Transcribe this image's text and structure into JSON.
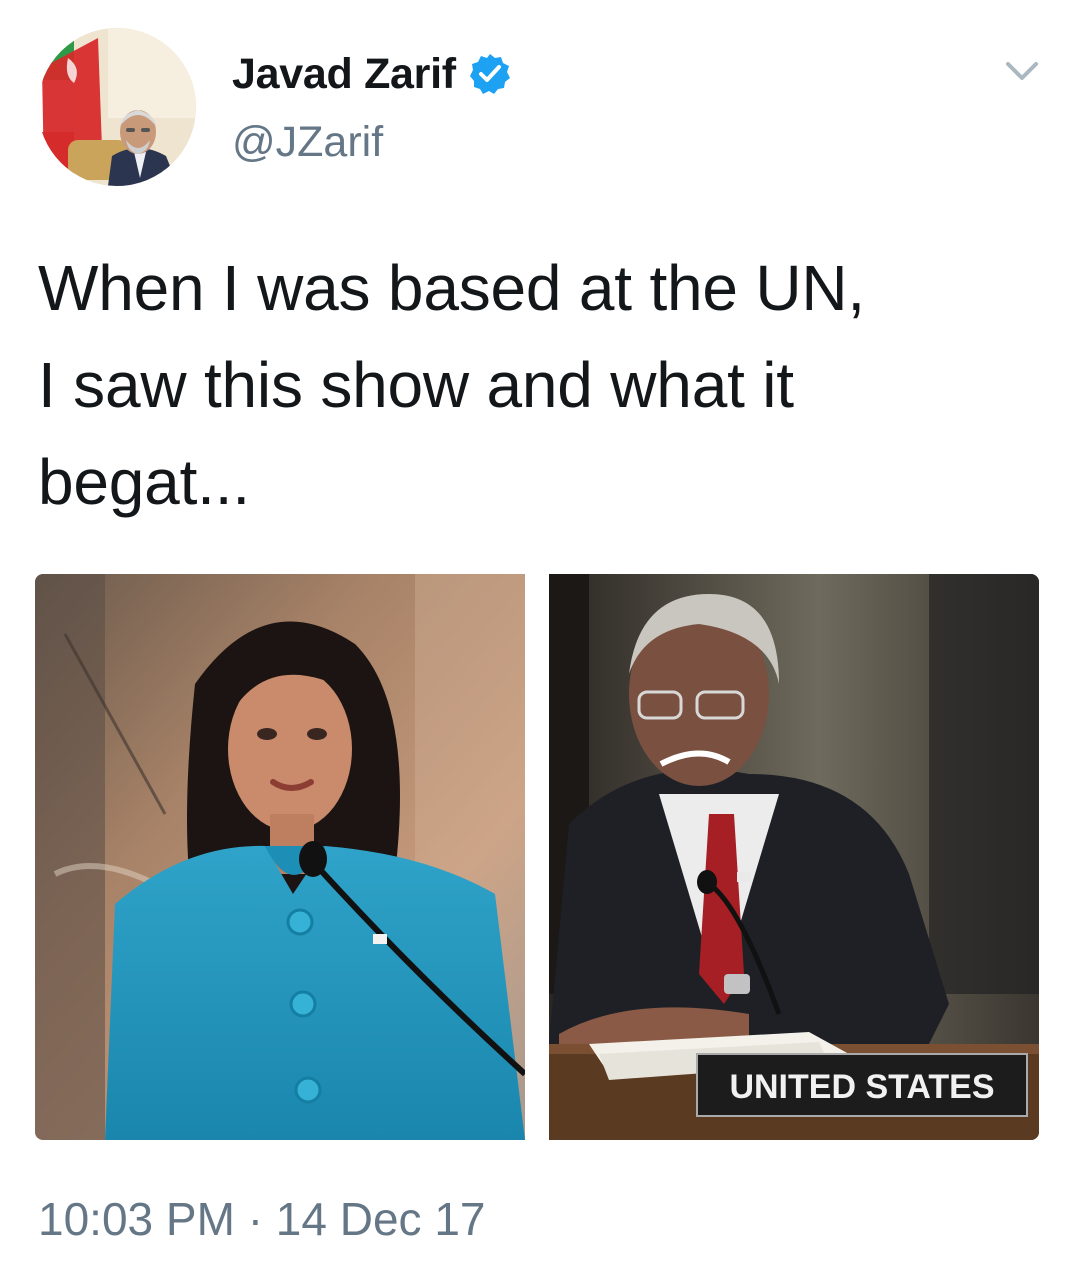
{
  "author": {
    "display_name": "Javad Zarif",
    "handle": "@JZarif",
    "verified": true
  },
  "tweet": {
    "text_lines": [
      "When I was based at the UN,",
      "I saw this show and what it",
      "begat..."
    ],
    "time": "10:03 PM",
    "separator": "·",
    "date": "14 Dec 17"
  },
  "media": {
    "right_photo": {
      "placard_text": "UNITED STATES"
    }
  },
  "icons": {
    "verified": "verified-badge-icon",
    "menu": "chevron-down-icon"
  },
  "colors": {
    "verified_blue": "#1da1f2",
    "secondary_text": "#657786",
    "primary_text": "#14171a"
  }
}
